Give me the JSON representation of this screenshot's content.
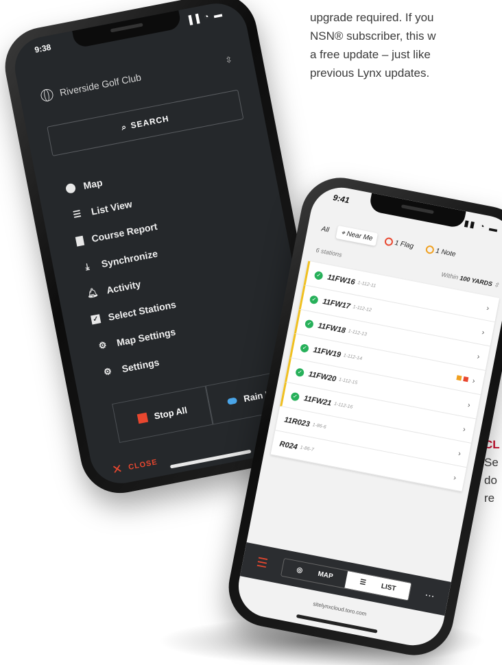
{
  "bg": {
    "lines": [
      "upgrade required. If you",
      "NSN® subscriber, this w",
      "a free update – just like",
      "previous Lynx updates."
    ],
    "cl_heading": "CL",
    "cl_lines": [
      "Se",
      "do",
      "re"
    ]
  },
  "left_phone": {
    "time": "9:38",
    "status_icons": "▐▐ ◔ ▬",
    "club": "Riverside Golf Club",
    "search": "SEARCH",
    "menu": [
      {
        "label": "Map",
        "icon": "circle-icon"
      },
      {
        "label": "List View",
        "icon": "list-icon"
      },
      {
        "label": "Course Report",
        "icon": "document-icon"
      },
      {
        "label": "Synchronize",
        "icon": "download-icon"
      },
      {
        "label": "Activity",
        "icon": "bell-icon"
      },
      {
        "label": "Select Stations",
        "icon": "checkbox-icon"
      },
      {
        "label": "Map Settings",
        "icon": "gears-icon"
      },
      {
        "label": "Settings",
        "icon": "gear-icon"
      }
    ],
    "stop_all": "Stop All",
    "rain_hold": "Rain Hold",
    "close": "CLOSE"
  },
  "right_phone": {
    "time": "9:41",
    "filters": {
      "all": "All",
      "near_me": "Near Me",
      "flag": "1 Flag",
      "note": "1 Note"
    },
    "stations_count": "6 stations",
    "within_prefix": "Within",
    "within_value": "100 YARDS",
    "rows": [
      {
        "name": "11FW16",
        "sub": "1-112-11",
        "ok": true
      },
      {
        "name": "11FW17",
        "sub": "1-112-12",
        "ok": true
      },
      {
        "name": "11FW18",
        "sub": "1-112-13",
        "ok": true
      },
      {
        "name": "11FW19",
        "sub": "1-112-14",
        "ok": true,
        "flags": true
      },
      {
        "name": "11FW20",
        "sub": "1-112-15",
        "ok": true
      },
      {
        "name": "11FW21",
        "sub": "1-112-16",
        "ok": true
      },
      {
        "name": "11R023",
        "sub": "1-86-6",
        "ok": false
      },
      {
        "name": "R024",
        "sub": "1-86-7",
        "ok": false
      }
    ],
    "map_label": "MAP",
    "list_label": "LIST",
    "url": "sitelynxcloud.toro.com"
  },
  "colors": {
    "accent": "#e8472f",
    "ok": "#27b05a",
    "dark": "#25282b"
  }
}
